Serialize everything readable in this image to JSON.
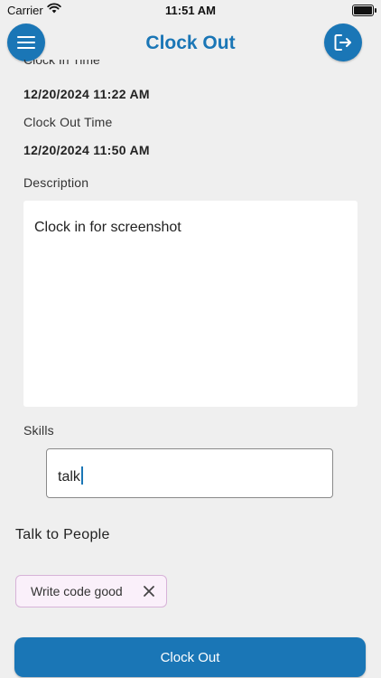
{
  "status_bar": {
    "carrier": "Carrier",
    "time": "11:51 AM"
  },
  "header": {
    "title": "Clock Out",
    "menu_icon": "hamburger-menu-icon",
    "logout_icon": "logout-icon"
  },
  "clock_in": {
    "label": "Clock In Time",
    "value": "12/20/2024 11:22 AM"
  },
  "clock_out": {
    "label": "Clock Out Time",
    "value": "12/20/2024 11:50 AM"
  },
  "description": {
    "label": "Description",
    "value": "Clock in for screenshot"
  },
  "skills": {
    "label": "Skills",
    "input_value": "talk",
    "suggestion": "Talk to People",
    "chips": [
      {
        "label": "Write code good"
      }
    ]
  },
  "actions": {
    "clock_out_label": "Clock Out"
  },
  "colors": {
    "accent": "#1a76b6",
    "background": "#efefef",
    "chip_border": "#d7b3d8",
    "chip_bg": "#faf0fa"
  }
}
